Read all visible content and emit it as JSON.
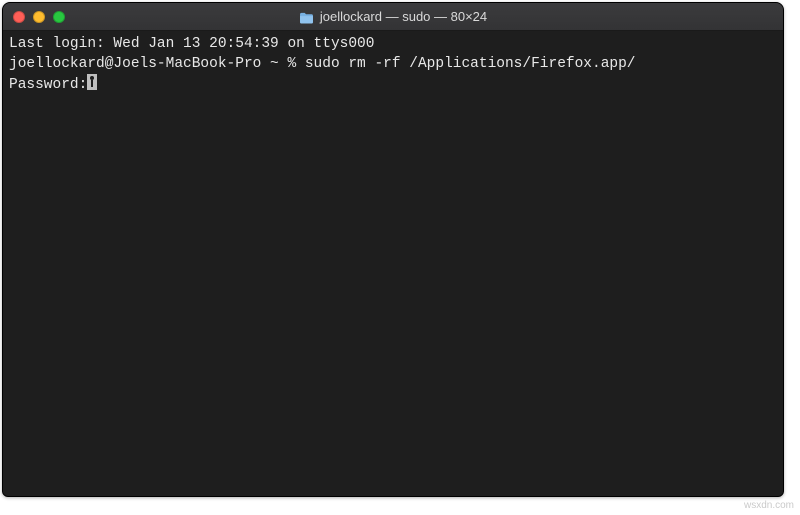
{
  "titlebar": {
    "title": "joellockard — sudo — 80×24",
    "icon": "folder-icon"
  },
  "terminal": {
    "lines": [
      {
        "text": "Last login: Wed Jan 13 20:54:39 on ttys000"
      },
      {
        "text": "joellockard@Joels-MacBook-Pro ~ % sudo rm -rf /Applications/Firefox.app/"
      },
      {
        "text": "Password:",
        "hasKeyCursor": true
      }
    ]
  },
  "watermark": "wsxdn.com"
}
